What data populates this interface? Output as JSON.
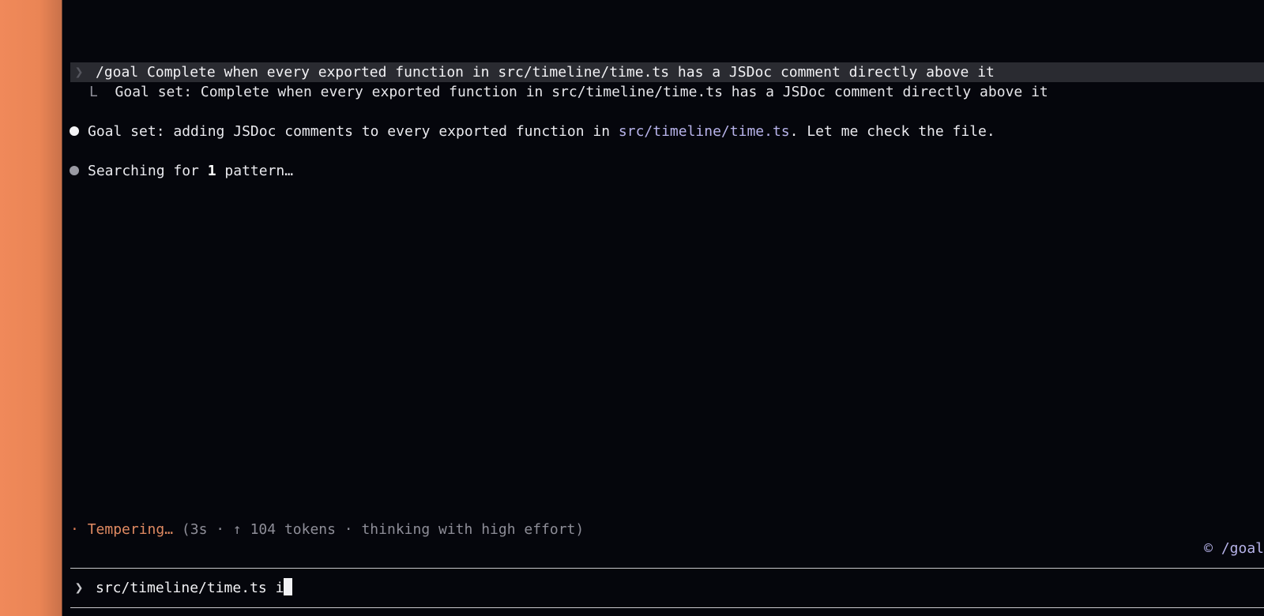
{
  "transcript": {
    "user_prompt_glyph": "❯",
    "user_message": "/goal Complete when every exported function in src/timeline/time.ts has a JSDoc comment directly above it",
    "goal_set_elbow": "L",
    "goal_set_message": "Goal set: Complete when every exported function in src/timeline/time.ts has a JSDoc comment directly above it",
    "assistant_message_prefix": "Goal set: adding JSDoc comments to every exported function in ",
    "assistant_message_path": "src/timeline/time.ts",
    "assistant_message_suffix": ". Let me check the file.",
    "search_prefix": "Searching for ",
    "search_count": "1",
    "search_suffix": " pattern…"
  },
  "status": {
    "dot": "·",
    "word": "Tempering…",
    "meta": " (3s · ↑ 104 tokens · thinking with high effort)"
  },
  "mode_indicator": "© /goal",
  "input": {
    "prompt_glyph": "❯",
    "value": "src/timeline/time.ts i"
  },
  "colors": {
    "background": "#05060c",
    "accent_orange": "#e08a62",
    "path_lavender": "#b7b3ea",
    "user_row_bg": "#2a2b31"
  }
}
